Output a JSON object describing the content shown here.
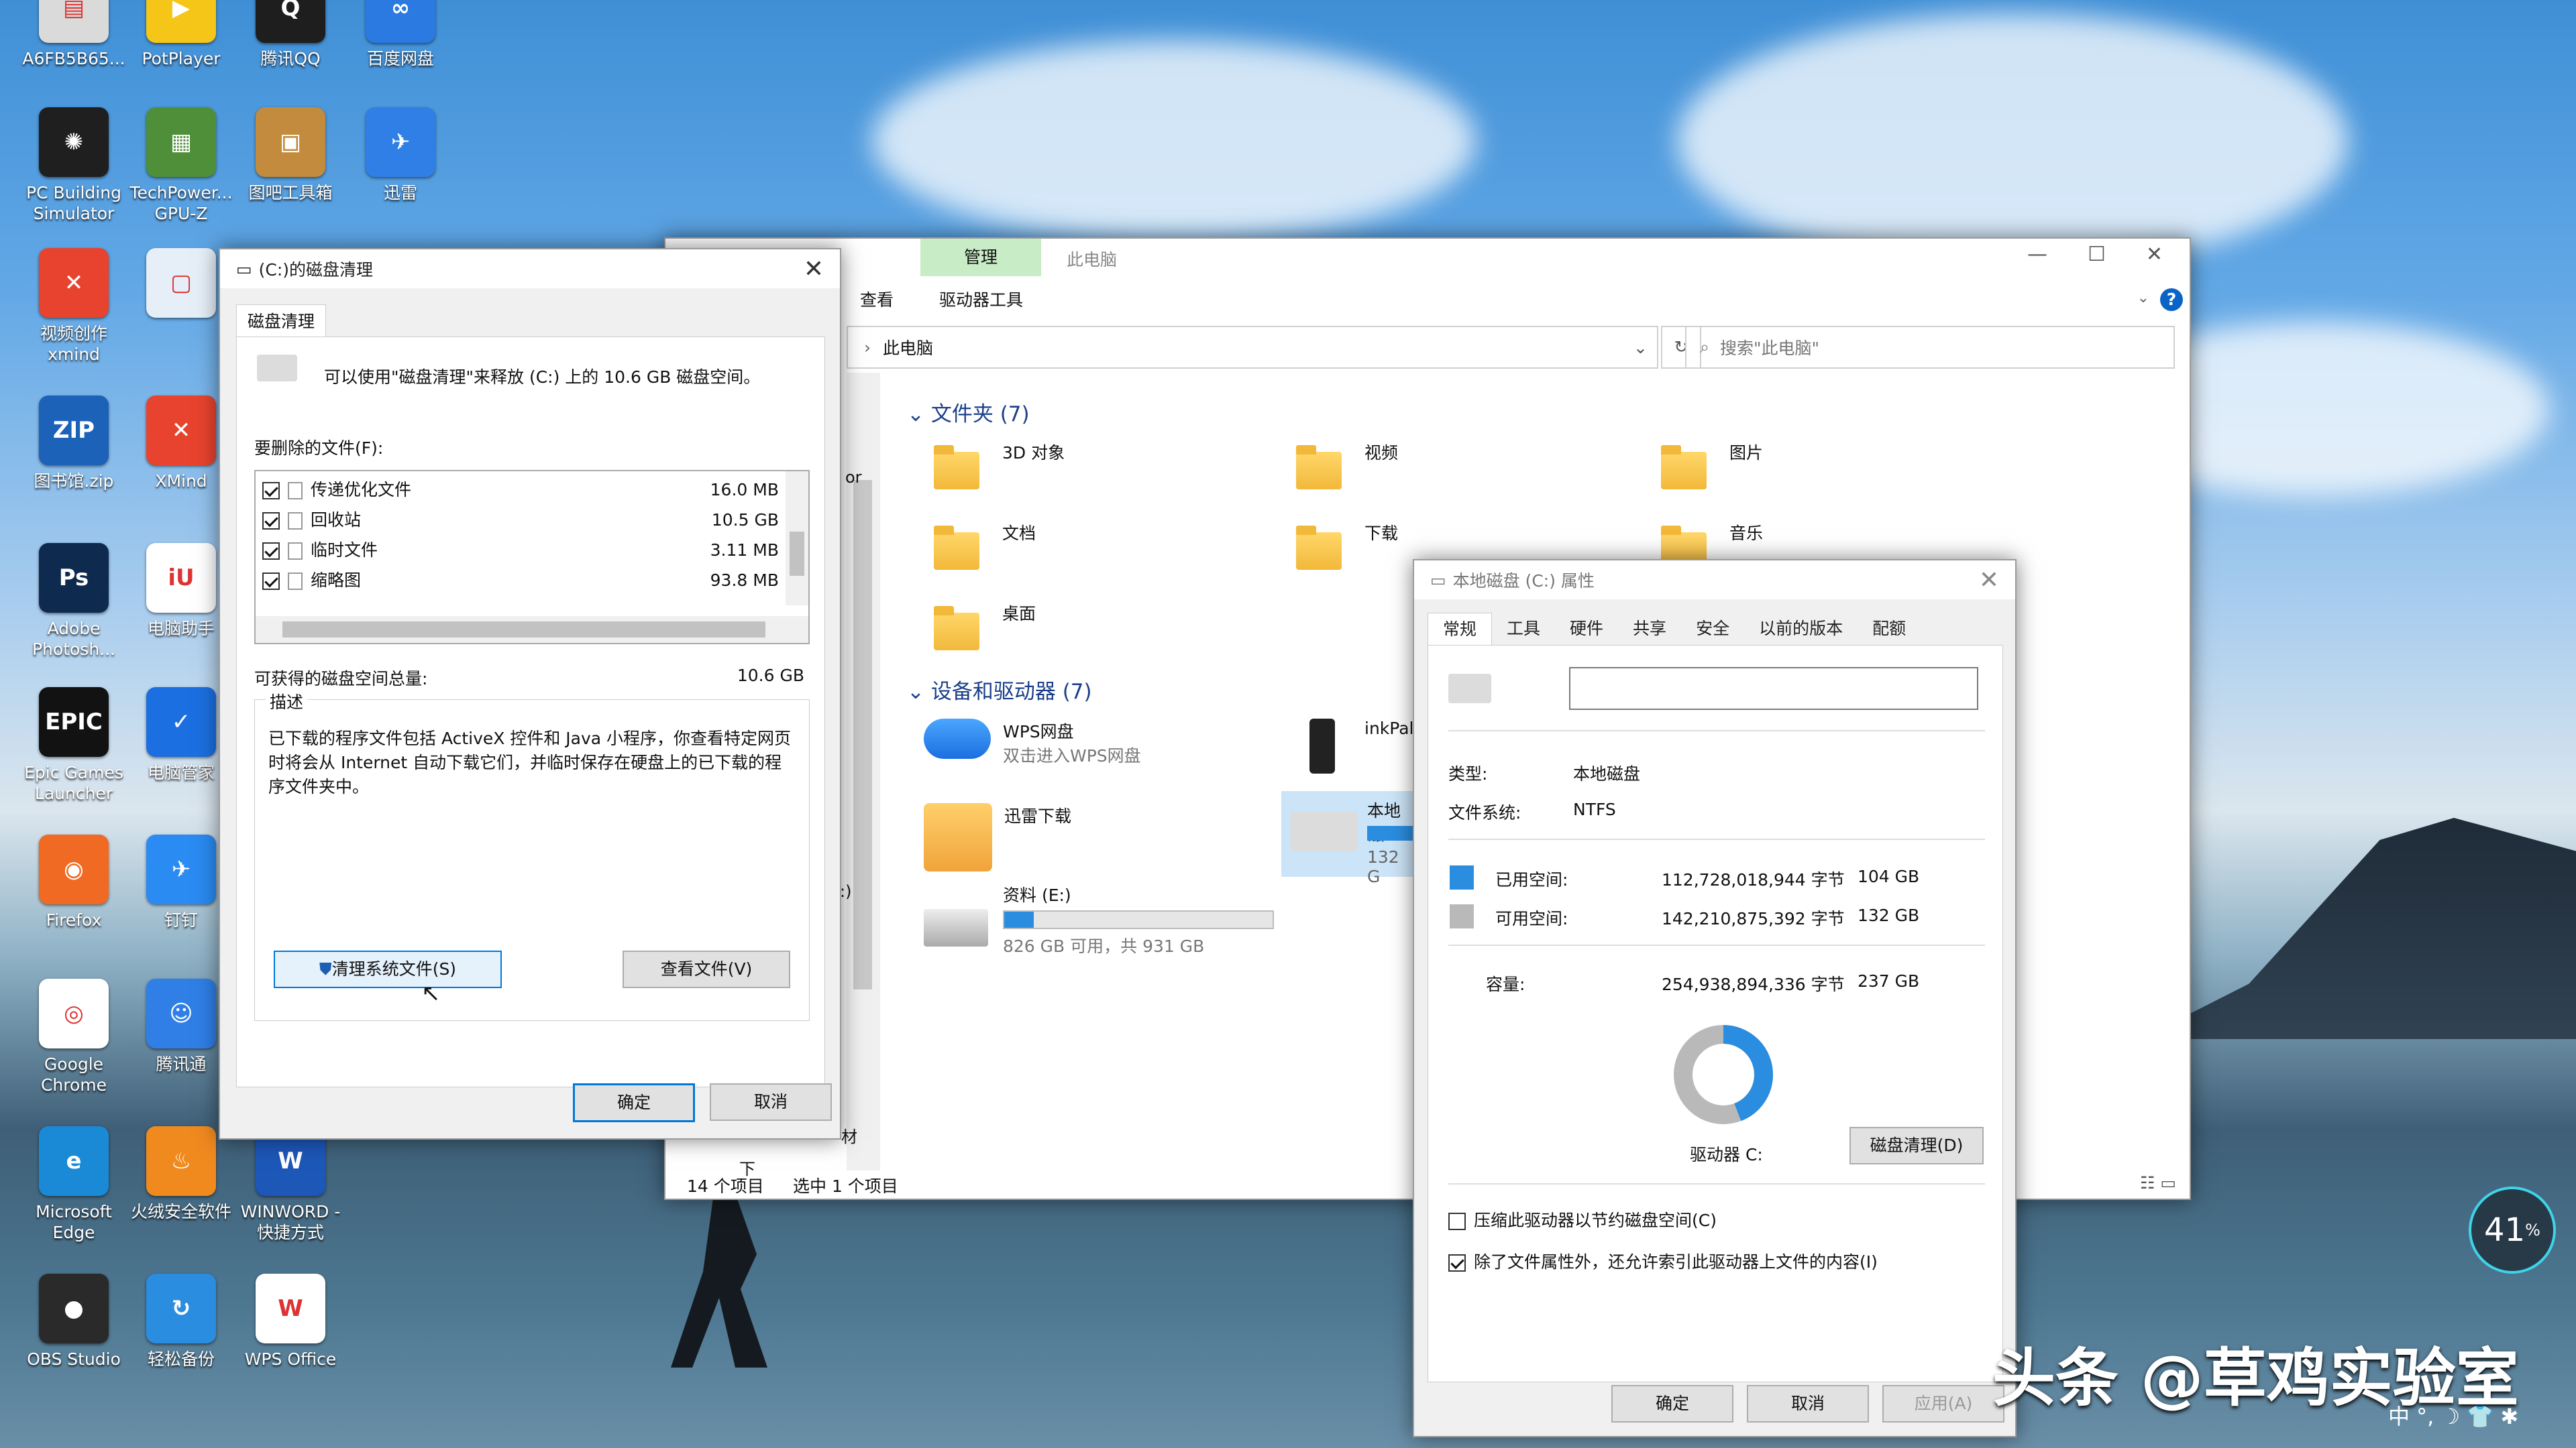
{
  "desktop": {
    "icons": [
      {
        "label": "A6FB5B65...",
        "color": "#dadada",
        "glyph": "▤"
      },
      {
        "label": "PotPlayer",
        "color": "#f5c518",
        "glyph": "▶"
      },
      {
        "label": "腾讯QQ",
        "color": "#1e1e1e",
        "glyph": "Q"
      },
      {
        "label": "百度网盘",
        "color": "#2a7ae2",
        "glyph": "∞"
      },
      {
        "label": "PC Building Simulator",
        "color": "#1f1f1f",
        "glyph": "✺"
      },
      {
        "label": "TechPower... GPU-Z",
        "color": "#4f8f3a",
        "glyph": "▦"
      },
      {
        "label": "图吧工具箱",
        "color": "#c28b3e",
        "glyph": "▣"
      },
      {
        "label": "迅雷",
        "color": "#2f7fe6",
        "glyph": "✈"
      },
      {
        "label": "视频创作 xmind",
        "color": "#e8432e",
        "glyph": "✕"
      },
      {
        "label": "",
        "color": "#e6eef8",
        "glyph": "▢"
      },
      {
        "label": "图书馆.zip",
        "color": "#1b62b8",
        "glyph": "ZIP"
      },
      {
        "label": "XMind",
        "color": "#e8432e",
        "glyph": "✕"
      },
      {
        "label": "Adobe Photosh...",
        "color": "#0e2a4f",
        "glyph": "Ps"
      },
      {
        "label": "电脑助手",
        "color": "#ffffff",
        "glyph": "iU"
      },
      {
        "label": "Epic Games Launcher",
        "color": "#121212",
        "glyph": "EPIC"
      },
      {
        "label": "电脑管家",
        "color": "#1c6fe0",
        "glyph": "✓"
      },
      {
        "label": "Firefox",
        "color": "#f06a23",
        "glyph": "◉"
      },
      {
        "label": "钉钉",
        "color": "#2a8bf2",
        "glyph": "✈"
      },
      {
        "label": "Google Chrome",
        "color": "#ffffff",
        "glyph": "◎"
      },
      {
        "label": "腾讯通",
        "color": "#2f7fe6",
        "glyph": "☺"
      },
      {
        "label": "Microsoft Edge",
        "color": "#1a8ad6",
        "glyph": "e"
      },
      {
        "label": "火绒安全软件",
        "color": "#f08a1f",
        "glyph": "♨"
      },
      {
        "label": "WINWORD - 快捷方式",
        "color": "#1d57b8",
        "glyph": "W"
      },
      {
        "label": "OBS Studio",
        "color": "#2a2a2a",
        "glyph": "●"
      },
      {
        "label": "轻松备份",
        "color": "#2a8de0",
        "glyph": "↻"
      },
      {
        "label": "WPS Office",
        "color": "#ffffff",
        "glyph": "W"
      }
    ]
  },
  "explorer": {
    "tab_manage": "管理",
    "tab_view": "查看",
    "tab_drive_tools": "驱动器工具",
    "window_title": "此电脑",
    "address": "此电脑",
    "search_placeholder": "搜索\"此电脑\"",
    "folders_header": "文件夹 (7)",
    "folders": [
      "3D 对象",
      "视频",
      "图片",
      "文档",
      "下载",
      "音乐",
      "桌面"
    ],
    "devices_header": "设备和驱动器 (7)",
    "wps": "WPS网盘",
    "wps_sub": "双击进入WPS网盘",
    "inkpal": "inkPal",
    "xunlei": "迅雷下载",
    "local_disk": "本地磁",
    "local_size": "132 G",
    "e_drive": "资料 (E:)",
    "e_free": "826 GB 可用，共 931 GB",
    "e_fill": 0.11,
    "status_items": "14 个项目",
    "status_selected": "选中 1 个项目",
    "left_fragment_1": "or",
    "left_fragment_2": ":)",
    "left_fragment_3": "材",
    "left_fragment_4": "下"
  },
  "cleanup": {
    "title": "(C:)的磁盘清理",
    "tab": "磁盘清理",
    "intro": "可以使用\"磁盘清理\"来释放 (C:) 上的 10.6 GB 磁盘空间。",
    "files_label": "要删除的文件(F):",
    "files": [
      {
        "name": "传递优化文件",
        "size": "16.0 MB",
        "checked": true
      },
      {
        "name": "回收站",
        "size": "10.5 GB",
        "checked": true
      },
      {
        "name": "临时文件",
        "size": "3.11 MB",
        "checked": true
      },
      {
        "name": "缩略图",
        "size": "93.8 MB",
        "checked": true
      }
    ],
    "total_label": "可获得的磁盘空间总量:",
    "total_value": "10.6 GB",
    "desc_label": "描述",
    "desc_text": "已下载的程序文件包括 ActiveX 控件和 Java 小程序，你查看特定网页时将会从 Internet 自动下载它们，并临时保存在硬盘上的已下载的程序文件夹中。",
    "clean_system": "清理系统文件(S)",
    "view_files": "查看文件(V)",
    "ok": "确定",
    "cancel": "取消"
  },
  "props": {
    "title": "本地磁盘 (C:) 属性",
    "tabs": [
      "常规",
      "工具",
      "硬件",
      "共享",
      "安全",
      "以前的版本",
      "配额"
    ],
    "name_value": "",
    "type_label": "类型:",
    "type_value": "本地磁盘",
    "fs_label": "文件系统:",
    "fs_value": "NTFS",
    "used_label": "已用空间:",
    "used_bytes": "112,728,018,944 字节",
    "used_gb": "104 GB",
    "free_label": "可用空间:",
    "free_bytes": "142,210,875,392 字节",
    "free_gb": "132 GB",
    "cap_label": "容量:",
    "cap_bytes": "254,938,894,336 字节",
    "cap_gb": "237 GB",
    "used_fraction": 0.442,
    "used_color": "#2a8de0",
    "free_color": "#b9b9b9",
    "drive_label": "驱动器 C:",
    "cleanup_btn": "磁盘清理(D)",
    "compress": "压缩此驱动器以节约磁盘空间(C)",
    "compress_checked": false,
    "index": "除了文件属性外，还允许索引此驱动器上文件的内容(I)",
    "index_checked": true,
    "ok": "确定",
    "cancel": "取消",
    "apply": "应用(A)"
  },
  "overlay": {
    "watermark": "头条 @草鸡实验室",
    "gauge": "41",
    "gauge_unit": "%",
    "tray": "中 °, ☽ 👕 ✱"
  }
}
